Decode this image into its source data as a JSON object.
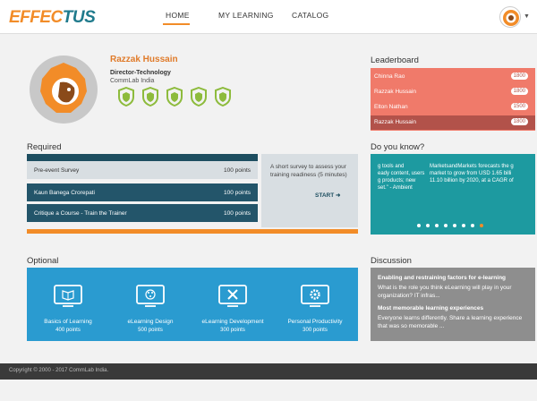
{
  "header": {
    "logo_part1": "EFFEC",
    "logo_part2": "TUS",
    "nav": [
      "HOME",
      "MY LEARNING",
      "CATALOG"
    ],
    "active_nav": "HOME",
    "accent_color": "#f28c28"
  },
  "profile": {
    "name": "Razzak Hussain",
    "role": "Director-Technology",
    "org": "CommLab India",
    "badge_count": 5,
    "badge_icon": "shield-badge-icon"
  },
  "leaderboard": {
    "title": "Leaderboard",
    "entries": [
      {
        "name": "Chinna Rao",
        "score": "1800"
      },
      {
        "name": "Razzak Hussain",
        "score": "1800"
      },
      {
        "name": "Elton Nathan",
        "score": "1500"
      },
      {
        "name": "Razzak Hussain",
        "score": "1800"
      }
    ]
  },
  "required": {
    "title": "Required",
    "items": [
      {
        "title": "Pre-event Survey",
        "points": "100 points"
      },
      {
        "title": "Kaun Banega Crorepati",
        "points": "100 points"
      },
      {
        "title": "Critique a Course - Train the Trainer",
        "points": "100 points"
      }
    ],
    "description": "A short survey to assess your training readiness (5 minutes)",
    "start_label": "START"
  },
  "did_you_know": {
    "title": "Do you know?",
    "col1": [
      "g tools and",
      "eady content, users",
      "g products; new",
      "set.\" - Ambient"
    ],
    "col2": [
      "MarketsandMarkets forecasts the g",
      "market to grow from USD 1.65 billi",
      "11.10 billion by 2020, at a CAGR of",
      ""
    ],
    "dot_count": 8,
    "active_dot": 7
  },
  "optional": {
    "title": "Optional",
    "items": [
      {
        "label": "Basics of Learning",
        "points": "400 points",
        "icon": "book-icon"
      },
      {
        "label": "eLearning Design",
        "points": "500 points",
        "icon": "design-icon"
      },
      {
        "label": "eLearning Development",
        "points": "300 points",
        "icon": "tools-icon"
      },
      {
        "label": "Personal Productivity",
        "points": "300 points",
        "icon": "gear-icon"
      }
    ]
  },
  "discussion": {
    "title": "Discussion",
    "posts": [
      {
        "heading": "Enabling and restraining factors for e-learning",
        "text": "What is the role you think eLearning will play in your organization? IT infras..."
      },
      {
        "heading": "Most memorable learning experiences",
        "text": "Everyone learns differently. Share a learning experience that was so memorable ..."
      }
    ]
  },
  "footer": {
    "copyright": "Copyright © 2000 - 2017 CommLab India."
  }
}
